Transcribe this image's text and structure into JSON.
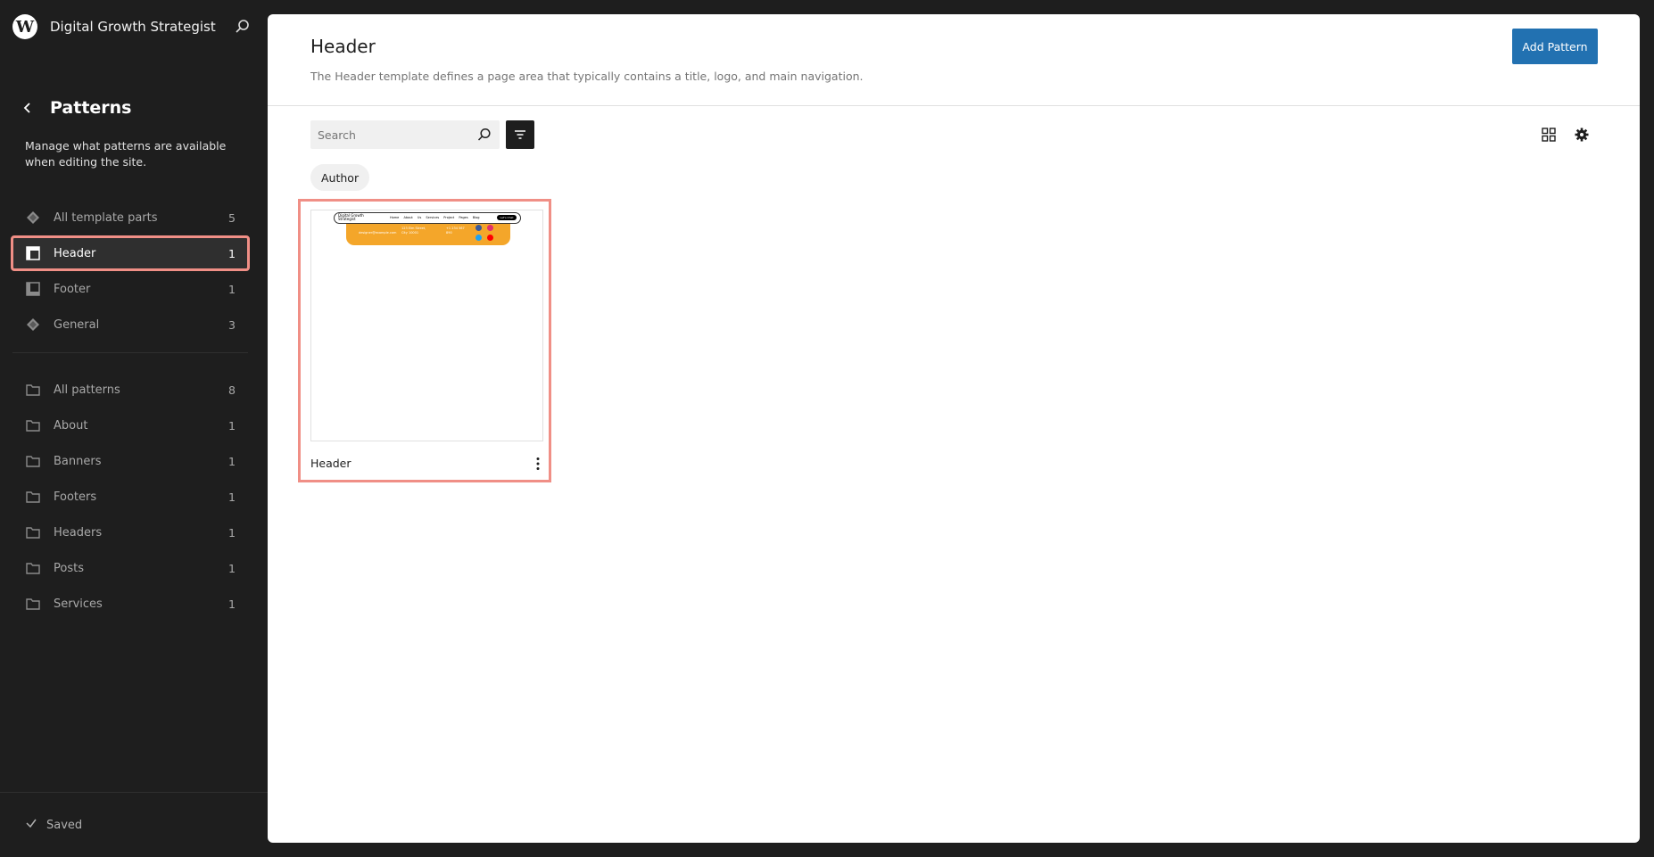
{
  "site": {
    "name": "Digital Growth Strategist",
    "logo_glyph": "W"
  },
  "sidebar": {
    "title": "Patterns",
    "description": "Manage what patterns are available when editing the site.",
    "template_parts": [
      {
        "label": "All template parts",
        "count": "5",
        "icon": "symbol-icon"
      },
      {
        "label": "Header",
        "count": "1",
        "icon": "header-icon",
        "active": true
      },
      {
        "label": "Footer",
        "count": "1",
        "icon": "footer-icon"
      },
      {
        "label": "General",
        "count": "3",
        "icon": "symbol-icon"
      }
    ],
    "categories": [
      {
        "label": "All patterns",
        "count": "8"
      },
      {
        "label": "About",
        "count": "1"
      },
      {
        "label": "Banners",
        "count": "1"
      },
      {
        "label": "Footers",
        "count": "1"
      },
      {
        "label": "Headers",
        "count": "1"
      },
      {
        "label": "Posts",
        "count": "1"
      },
      {
        "label": "Services",
        "count": "1"
      }
    ],
    "status": "Saved"
  },
  "main": {
    "title": "Header",
    "description": "The Header template defines a page area that typically contains a title, logo, and main navigation.",
    "add_button": "Add Pattern",
    "search_placeholder": "Search",
    "author_chip": "Author",
    "cards": [
      {
        "title": "Header"
      }
    ]
  },
  "preview": {
    "logo_text": "Digital Growth Strategist",
    "nav_links": "Home About Us Services Project Pages Blog",
    "cta": "Let's Chat",
    "email": "designer@example.com",
    "address": "123 Elm Street, City 10001",
    "phone": "+1 234 567 890",
    "social_colors": [
      "#3b5998",
      "#e1306c",
      "#1da1f2",
      "#ff0000"
    ]
  },
  "colors": {
    "accent": "#2271b1",
    "highlight": "#f08f86",
    "preview_band": "#f4a62a"
  }
}
